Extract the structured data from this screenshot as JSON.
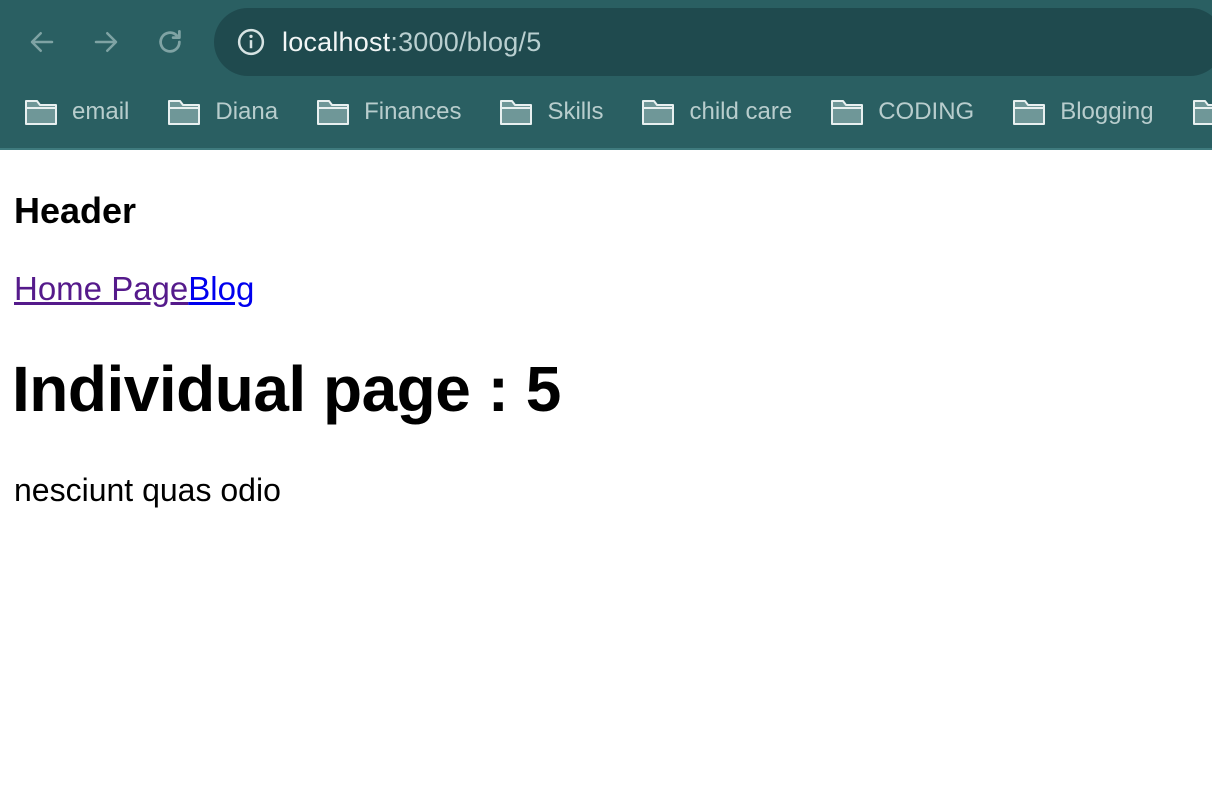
{
  "browser": {
    "url_host": "localhost",
    "url_rest": ":3000/blog/5",
    "icons": {
      "back": "arrow-left-icon",
      "forward": "arrow-right-icon",
      "reload": "reload-icon",
      "site_info": "info-icon",
      "bookmark_folder": "folder-icon"
    },
    "colors": {
      "chrome_background": "#2a5f62",
      "omnibox_background": "#1f4a4e"
    },
    "bookmarks": [
      {
        "label": "email"
      },
      {
        "label": "Diana"
      },
      {
        "label": "Finances"
      },
      {
        "label": "Skills"
      },
      {
        "label": "child care"
      },
      {
        "label": "CODING"
      },
      {
        "label": "Blogging"
      },
      {
        "label": ""
      }
    ]
  },
  "page": {
    "header": "Header",
    "nav": {
      "home_label": "Home Page",
      "blog_label": "Blog"
    },
    "title": "Individual page : 5",
    "body": "nesciunt quas odio",
    "colors": {
      "visited_link": "#551a8b",
      "link": "#0000ee"
    }
  }
}
